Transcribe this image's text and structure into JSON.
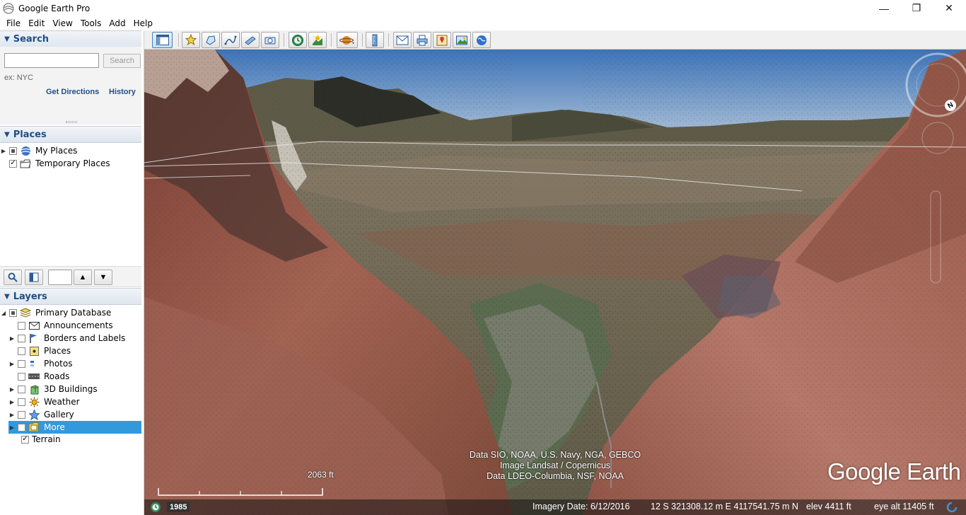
{
  "window": {
    "title": "Google Earth Pro",
    "minimize": "—",
    "maximize": "❐",
    "close": "✕"
  },
  "menu": [
    "File",
    "Edit",
    "View",
    "Tools",
    "Add",
    "Help"
  ],
  "search": {
    "header": "Search",
    "input_value": "",
    "button": "Search",
    "hint": "ex: NYC",
    "get_directions": "Get Directions",
    "history": "History"
  },
  "places": {
    "header": "Places",
    "items": [
      {
        "label": "My Places",
        "checked": "partial",
        "icon": "globe-icon"
      },
      {
        "label": "Temporary Places",
        "checked": "true",
        "icon": "folder-icon"
      }
    ]
  },
  "layers": {
    "header": "Layers",
    "items": [
      {
        "label": "Primary Database",
        "icon": "database-icon"
      },
      {
        "label": "Announcements",
        "icon": "envelope-icon"
      },
      {
        "label": "Borders and Labels",
        "icon": "flag-icon"
      },
      {
        "label": "Places",
        "icon": "places-icon"
      },
      {
        "label": "Photos",
        "icon": "photos-icon"
      },
      {
        "label": "Roads",
        "icon": "road-icon"
      },
      {
        "label": "3D Buildings",
        "icon": "building-icon"
      },
      {
        "label": "Weather",
        "icon": "sun-icon"
      },
      {
        "label": "Gallery",
        "icon": "star-icon"
      },
      {
        "label": "More",
        "icon": "folder-icon"
      },
      {
        "label": "Terrain",
        "icon": "none"
      }
    ],
    "selected": "More"
  },
  "map": {
    "attribution": [
      "Data SIO, NOAA, U.S. Navy, NGA, GEBCO",
      "Image Landsat / Copernicus",
      "Data LDEO-Columbia, NSF, NOAA"
    ],
    "brand": "Google Earth",
    "scale_label": "2063 ft"
  },
  "status": {
    "year": "1985",
    "imagery_date": "Imagery Date: 6/12/2016",
    "coordinates": "12 S 321308.12 m E 4117541.75 m N",
    "elev": "elev  4411 ft",
    "eye_alt": "eye alt  11405 ft"
  },
  "colors": {
    "accent": "#1f4f86",
    "selection": "#3399dd",
    "sky_top": "#3d73b8",
    "sky_horizon": "#b9cbdc",
    "canyon": "#9a5a4a"
  }
}
